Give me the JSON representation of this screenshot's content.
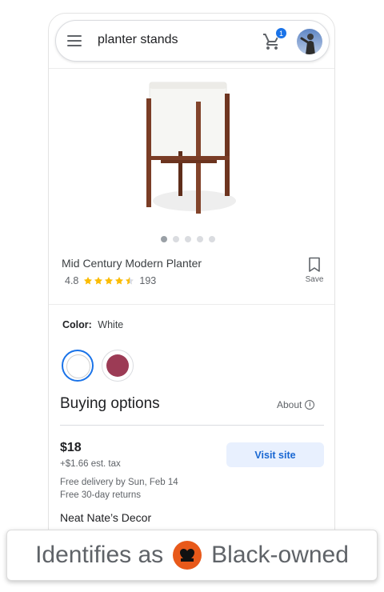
{
  "search": {
    "query": "planter stands",
    "cart_count": "1"
  },
  "product": {
    "title": "Mid Century Modern Planter",
    "rating": "4.8",
    "rating_stars": 4.5,
    "review_count": "193",
    "save_label": "Save",
    "image_count": 5,
    "active_image": 0
  },
  "color": {
    "label": "Color:",
    "value": "White",
    "swatches": [
      "white",
      "plum"
    ]
  },
  "buying": {
    "title": "Buying options",
    "about_label": "About",
    "price": "$18",
    "tax": "+$1.66 est. tax",
    "delivery": "Free delivery by Sun, Feb 14",
    "returns": "Free 30-day returns",
    "seller": "Neat Nate’s Decor",
    "visit_label": "Visit site"
  },
  "callout": {
    "prefix": "Identifies as",
    "suffix": "Black-owned"
  },
  "colors": {
    "accent": "#1a73e8",
    "star": "#fbbc04",
    "plum": "#9c3b55",
    "black_owned_badge": "#e8591a"
  },
  "icons": [
    "menu-icon",
    "cart-icon",
    "avatar",
    "bookmark-icon",
    "info-icon",
    "black-owned-icon"
  ]
}
